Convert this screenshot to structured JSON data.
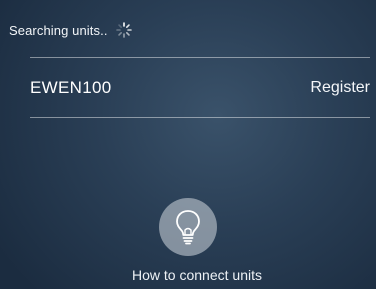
{
  "status": {
    "text": "Searching units..",
    "spinner_icon": "loading-spinner-icon"
  },
  "units": [
    {
      "name": "EWEN100",
      "action_label": "Register"
    }
  ],
  "help": {
    "icon": "lightbulb-icon",
    "label": "How to connect units"
  },
  "colors": {
    "background": "#2a3f56",
    "text": "#ffffff",
    "help_circle": "#bec6ce"
  }
}
